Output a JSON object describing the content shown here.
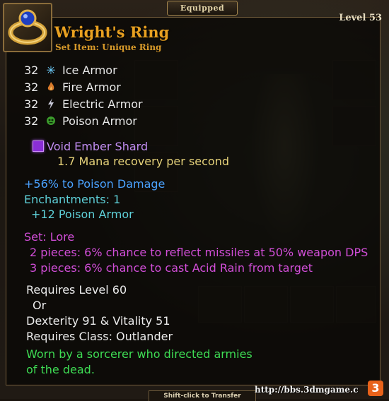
{
  "tab": {
    "label": "Equipped"
  },
  "item": {
    "name": "Wright's Ring",
    "type": "Set Item: Unique Ring",
    "level": "Level 53"
  },
  "armor": [
    {
      "value": "32",
      "label": "Ice Armor",
      "icon": "ice-icon",
      "color": "#6fd0ff"
    },
    {
      "value": "32",
      "label": "Fire Armor",
      "icon": "fire-icon",
      "color": "#e08a3a"
    },
    {
      "value": "32",
      "label": "Electric Armor",
      "icon": "lightning-icon",
      "color": "#c8c8d8"
    },
    {
      "value": "32",
      "label": "Poison Armor",
      "icon": "poison-icon",
      "color": "#5bd04a"
    }
  ],
  "gem": {
    "name": "Void Ember Shard",
    "effect": "1.7 Mana recovery per second"
  },
  "bonus": {
    "damage": "+56% to Poison Damage",
    "enchantments": "Enchantments: 1",
    "enchant_effect": "+12 Poison Armor"
  },
  "set": {
    "name": "Set: Lore",
    "bonuses": [
      "2 pieces: 6% chance to reflect missiles at 50% weapon DPS",
      "3 pieces: 6% chance to cast Acid Rain from target"
    ]
  },
  "requirements": {
    "level": "Requires Level 60",
    "or": "Or",
    "stats": "Dexterity 91 & Vitality 51",
    "class": "Requires Class: Outlander"
  },
  "flavor": {
    "line1": "Worn by a sorcerer who directed armies",
    "line2": "of the dead."
  },
  "footer": {
    "label": "Shift-click to Transfer"
  },
  "watermark": {
    "url": "http://bbs.3dmgame.c",
    "logo": "3"
  },
  "colors": {
    "item_name": "#e8a020",
    "gem": "#c08cf0",
    "gem_effect": "#e6d27a",
    "damage": "#4aa2ff",
    "enchant": "#5ed0d8",
    "set": "#d24ed8",
    "flavor": "#3edc54"
  }
}
